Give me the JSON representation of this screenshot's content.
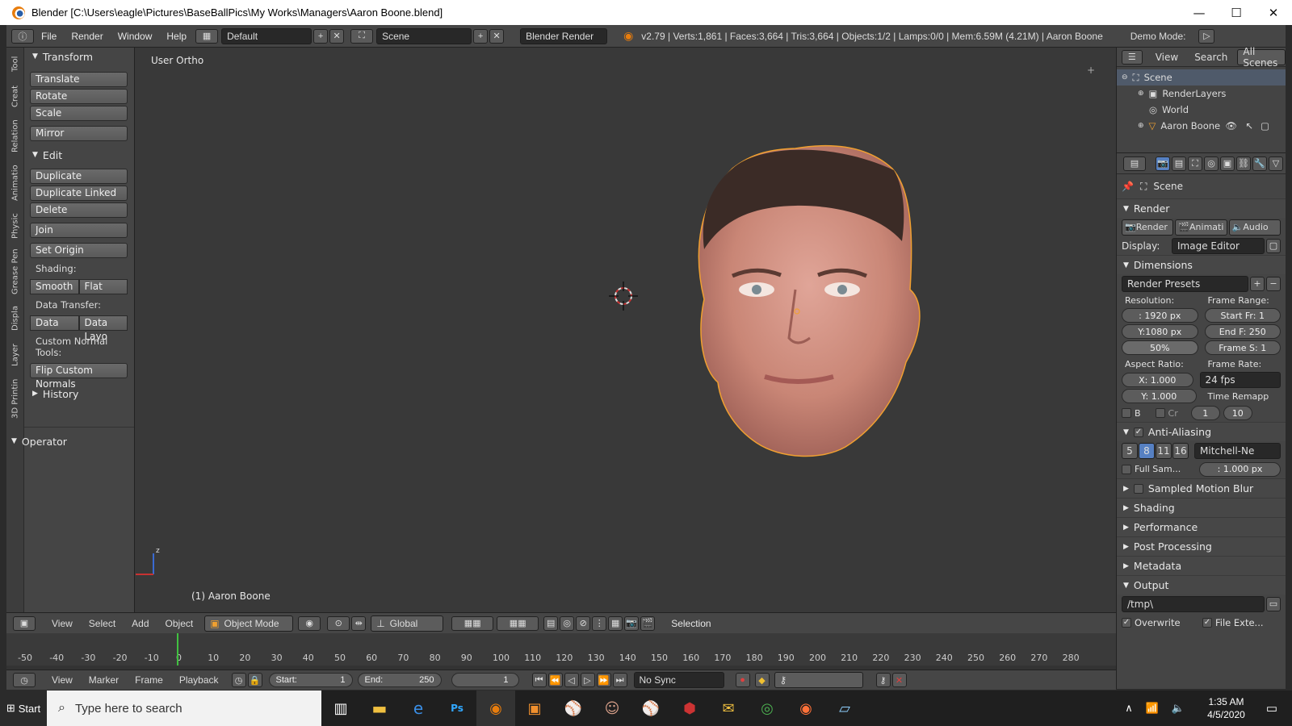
{
  "window": {
    "title": "Blender [C:\\Users\\eagle\\Pictures\\BaseBallPics\\My Works\\Managers\\Aaron Boone.blend]",
    "minimize": "—",
    "maximize": "☐",
    "close": "✕"
  },
  "menubar": {
    "items": [
      "File",
      "Render",
      "Window",
      "Help"
    ],
    "layout": "Default",
    "scene": "Scene",
    "engine": "Blender Render",
    "stats": "v2.79 | Verts:1,861 | Faces:3,664 | Tris:3,664 | Objects:1/2 | Lamps:0/0 | Mem:6.59M (4.21M) | Aaron Boone",
    "demo_mode": "Demo Mode:"
  },
  "left_tabs": [
    "Tool",
    "Creat",
    "Relation",
    "Animatio",
    "Physic",
    "Grease Pen",
    "Displa",
    "Layer",
    "3D Printin"
  ],
  "toolshelf": {
    "transform_title": "Transform",
    "translate": "Translate",
    "rotate": "Rotate",
    "scale": "Scale",
    "mirror": "Mirror",
    "edit_title": "Edit",
    "duplicate": "Duplicate",
    "duplicate_linked": "Duplicate Linked",
    "delete": "Delete",
    "join": "Join",
    "set_origin": "Set Origin",
    "shading_label": "Shading:",
    "smooth": "Smooth",
    "flat": "Flat",
    "data_transfer_label": "Data Transfer:",
    "data": "Data",
    "data_layout": "Data Layo",
    "custom_normal_label": "Custom Normal Tools:",
    "flip_normals": "Flip Custom Normals",
    "history_title": "History",
    "operator_title": "Operator"
  },
  "viewport": {
    "view_label": "User Ortho",
    "object_label": "(1) Aaron Boone"
  },
  "outliner": {
    "view": "View",
    "search": "Search",
    "all_scenes": "All Scenes",
    "items": [
      "Scene",
      "RenderLayers",
      "World",
      "Aaron Boone"
    ]
  },
  "properties": {
    "scene": "Scene",
    "render_title": "Render",
    "render_btn": "Render",
    "anim_btn": "Animati",
    "audio_btn": "Audio",
    "display_label": "Display:",
    "display_value": "Image Editor",
    "dimensions_title": "Dimensions",
    "render_presets": "Render Presets",
    "resolution_label": "Resolution:",
    "frame_range_label": "Frame Range:",
    "res_x": ": 1920 px",
    "res_y": "Y:1080 px",
    "res_pct": "50%",
    "start_fr": "Start Fr: 1",
    "end_fr": "End F: 250",
    "frame_s": "Frame S: 1",
    "aspect_label": "Aspect Ratio:",
    "frame_rate_label": "Frame Rate:",
    "asp_x": "X:  1.000",
    "asp_y": "Y:  1.000",
    "fps": "24 fps",
    "time_remap": "Time Remapp",
    "b": "B",
    "cr": "Cr",
    "remap_old": "1",
    "remap_new": "10",
    "aa_title": "Anti-Aliasing",
    "aa_samples": [
      "5",
      "8",
      "11",
      "16"
    ],
    "aa_filter": "Mitchell-Ne",
    "full_sample": "Full Sam...",
    "filter_size": ": 1.000 px",
    "motion_blur": "Sampled Motion Blur",
    "shading": "Shading",
    "performance": "Performance",
    "post_processing": "Post Processing",
    "metadata": "Metadata",
    "output": "Output",
    "output_path": "/tmp\\",
    "overwrite": "Overwrite",
    "file_ext": "File Exte..."
  },
  "view3d_header": {
    "view": "View",
    "select": "Select",
    "add": "Add",
    "object": "Object",
    "mode": "Object Mode",
    "orientation": "Global",
    "selection": "Selection"
  },
  "timeline": {
    "ticks": [
      "-50",
      "-40",
      "-30",
      "-20",
      "-10",
      "0",
      "10",
      "20",
      "30",
      "40",
      "50",
      "60",
      "70",
      "80",
      "90",
      "100",
      "110",
      "120",
      "130",
      "140",
      "150",
      "160",
      "170",
      "180",
      "190",
      "200",
      "210",
      "220",
      "230",
      "240",
      "250",
      "260",
      "270",
      "280"
    ],
    "current_frame": 0,
    "view": "View",
    "marker": "Marker",
    "frame": "Frame",
    "playback": "Playback",
    "start": "Start:",
    "start_value": "1",
    "end": "End:",
    "end_value": "250",
    "current": "1",
    "sync": "No Sync"
  },
  "taskbar": {
    "start": "Start",
    "search_placeholder": "Type here to search",
    "time": "1:35 AM",
    "date": "4/5/2020"
  },
  "colors": {
    "accent_blue": "#5680c2",
    "selection_orange": "#f0a030",
    "timeline_cursor": "#40c040"
  }
}
